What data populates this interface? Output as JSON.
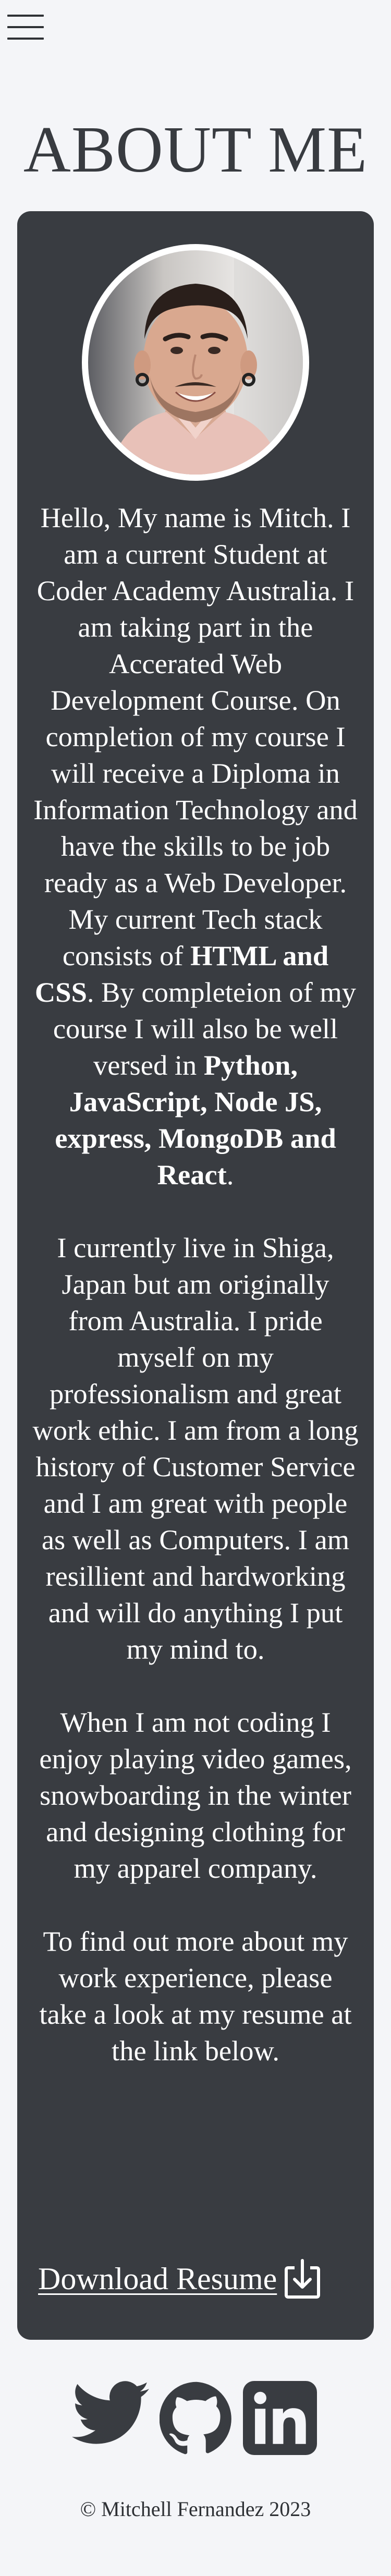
{
  "header": {
    "menu_icon": "hamburger-menu-icon"
  },
  "page": {
    "title": "ABOUT ME"
  },
  "profile": {
    "photo_description_icon": "profile-photo"
  },
  "bio": {
    "p1_a": "Hello, My name is Mitch. I am a current Student at Coder Academy Australia. I am taking part in the Accerated Web Development Course. On completion of my course I will receive a Diploma in Information Technology and have the skills to be job ready as a Web Developer. My current Tech stack consists of ",
    "p1_b": "HTML and CSS",
    "p1_c": ". By completeion of my course I will also be well versed in ",
    "p1_d": "Python, JavaScript, Node JS, express, MongoDB and React",
    "p1_e": ".",
    "p2": "I currently live in Shiga, Japan but am originally from Australia. I pride myself on my professionalism and great work ethic. I am from a long history of Customer Service and I am great with people as well as Computers. I am resillient and hardworking and will do anything I put my mind to.",
    "p3": "When I am not coding I enjoy playing video games, snowboarding in the winter and designing clothing for my apparel company.",
    "p4": "To find out more about my work experience, please take a look at my resume at the link below."
  },
  "resume": {
    "label": "Download Resume",
    "icon": "download-icon"
  },
  "socials": [
    {
      "name": "Twitter",
      "icon": "twitter-icon"
    },
    {
      "name": "GitHub",
      "icon": "github-icon"
    },
    {
      "name": "LinkedIn",
      "icon": "linkedin-icon"
    }
  ],
  "footer": {
    "copyright": "© Mitchell Fernandez 2023"
  },
  "colors": {
    "card": "#393c41",
    "background": "#f4f5f8",
    "text_dark": "#2e3135"
  }
}
